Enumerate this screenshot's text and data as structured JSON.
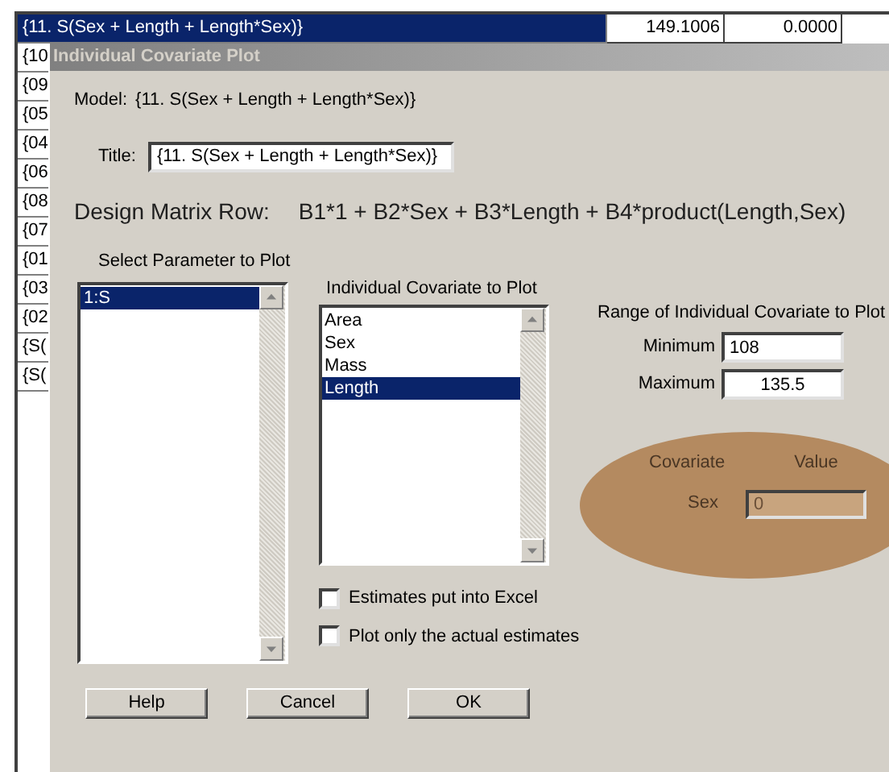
{
  "background_table": {
    "rows": [
      {
        "selected": true,
        "cells": [
          "{11. S(Sex + Length + Length*Sex)}",
          "149.1006",
          "0.0000"
        ]
      },
      {
        "selected": false,
        "cells": [
          "{10"
        ]
      },
      {
        "selected": false,
        "cells": [
          "{09"
        ]
      },
      {
        "selected": false,
        "cells": [
          "{05"
        ]
      },
      {
        "selected": false,
        "cells": [
          "{04"
        ]
      },
      {
        "selected": false,
        "cells": [
          "{06"
        ]
      },
      {
        "selected": false,
        "cells": [
          "{08"
        ]
      },
      {
        "selected": false,
        "cells": [
          "{07"
        ]
      },
      {
        "selected": false,
        "cells": [
          "{01"
        ]
      },
      {
        "selected": false,
        "cells": [
          "{03"
        ]
      },
      {
        "selected": false,
        "cells": [
          "{02"
        ]
      },
      {
        "selected": false,
        "cells": [
          "{S("
        ]
      },
      {
        "selected": false,
        "cells": [
          "{S("
        ]
      }
    ]
  },
  "dialog": {
    "title": "Individual Covariate Plot",
    "model_label": "Model:",
    "model_value": "{11. S(Sex + Length + Length*Sex)}",
    "title_label": "Title:",
    "title_value": "{11. S(Sex + Length + Length*Sex)}",
    "design_label": "Design Matrix Row:",
    "design_value": "B1*1 + B2*Sex + B3*Length + B4*product(Length,Sex)",
    "parameter_list": {
      "label": "Select Parameter to Plot",
      "items": [
        {
          "text": "1:S",
          "selected": true
        }
      ]
    },
    "covariate_list": {
      "label": "Individual Covariate to Plot",
      "items": [
        {
          "text": "Area",
          "selected": false
        },
        {
          "text": "Sex",
          "selected": false
        },
        {
          "text": "Mass",
          "selected": false
        },
        {
          "text": "Length",
          "selected": true
        }
      ]
    },
    "range": {
      "label": "Range of Individual Covariate to Plot",
      "minimum_label": "Minimum",
      "minimum_value": "108",
      "maximum_label": "Maximum",
      "maximum_value": "135.5"
    },
    "covariate_values": {
      "header_covariate": "Covariate",
      "header_value": "Value",
      "rows": [
        {
          "name": "Sex",
          "value": "0",
          "disabled": true
        }
      ]
    },
    "checkboxes": [
      {
        "label": "Estimates put into Excel",
        "checked": false
      },
      {
        "label": "Plot only the actual estimates",
        "checked": false
      }
    ],
    "buttons": [
      "Help",
      "Cancel",
      "OK"
    ]
  }
}
